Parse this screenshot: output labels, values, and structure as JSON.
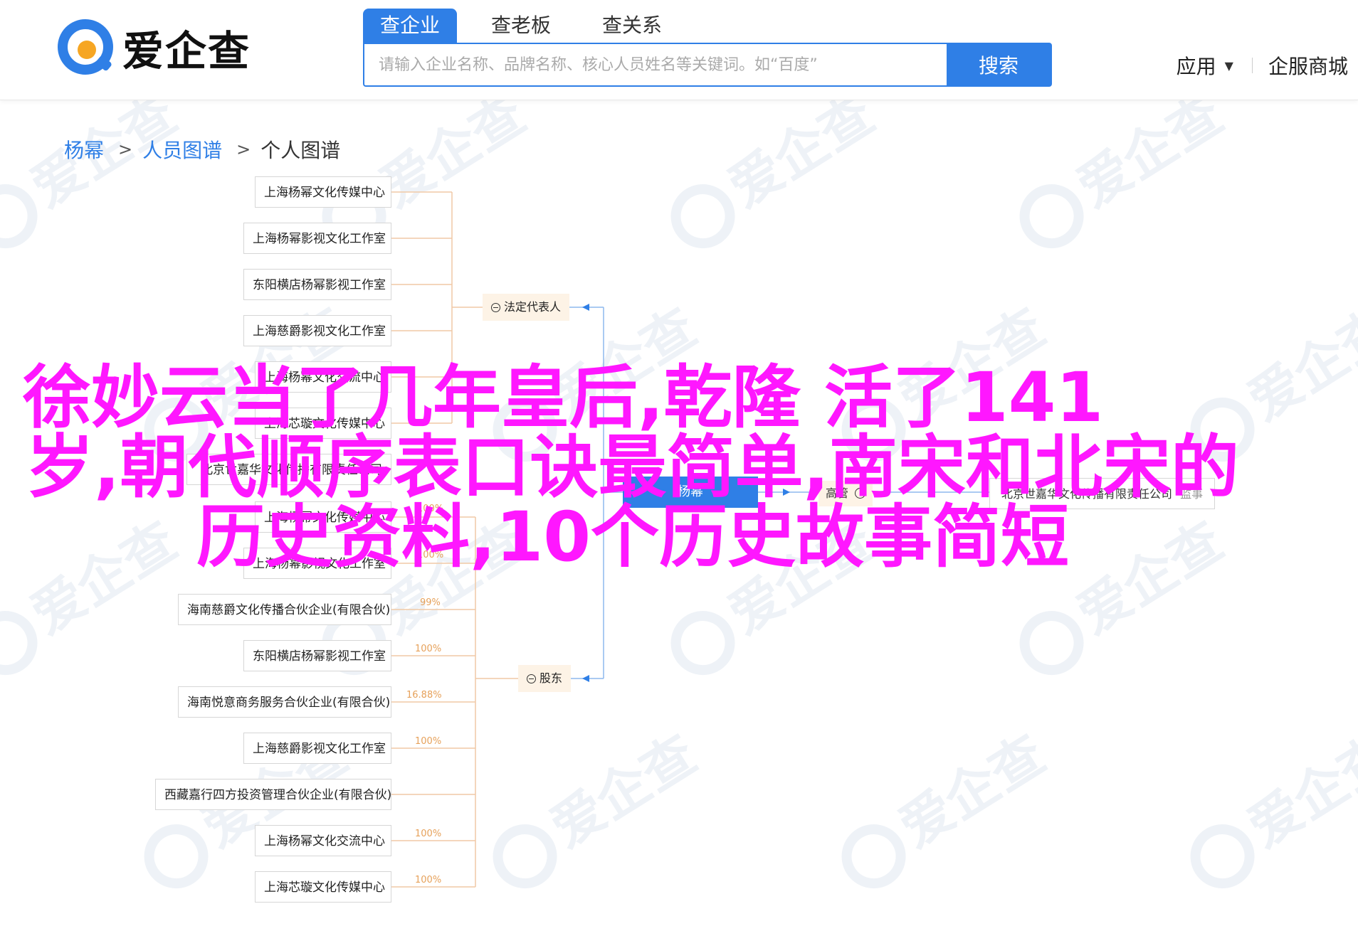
{
  "header": {
    "logo_text": "爱企查",
    "logo_colors": {
      "ring": "#2f7fe6",
      "dot": "#f6a623"
    },
    "search_tabs": [
      {
        "label": "查企业",
        "active": true
      },
      {
        "label": "查老板",
        "active": false
      },
      {
        "label": "查关系",
        "active": false
      }
    ],
    "search_placeholder": "请输入企业名称、品牌名称、核心人员姓名等关键词。如“百度”",
    "search_button": "搜索",
    "apps_label": "应用",
    "enterprise_mall": "企服商城"
  },
  "breadcrumb": {
    "items": [
      "杨幂",
      "人员图谱",
      "个人图谱"
    ]
  },
  "tree": {
    "legal_rep_label": "法定代表人",
    "legal_rep_companies": [
      "上海杨幂文化传媒中心",
      "上海杨幂影视文化工作室",
      "东阳横店杨幂影视工作室",
      "上海慈爵影视文化工作室",
      "上海杨幂文化交流中心",
      "上海芯璇文化传媒中心",
      "北京世嘉华文化传播有限责任公司"
    ],
    "shareholder_label": "股东",
    "shareholder_companies": [
      {
        "name": "上海杨幂文化传媒中心",
        "pct": "100%"
      },
      {
        "name": "上海杨幂影视文化工作室",
        "pct": "100%"
      },
      {
        "name": "海南慈爵文化传播合伙企业(有限合伙)",
        "pct": "99%"
      },
      {
        "name": "东阳横店杨幂影视工作室",
        "pct": "100%"
      },
      {
        "name": "海南悦意商务服务合伙企业(有限合伙)",
        "pct": "16.88%"
      },
      {
        "name": "上海慈爵影视文化工作室",
        "pct": "100%"
      },
      {
        "name": "西藏嘉行四方投资管理合伙企业(有限合伙)",
        "pct": ""
      },
      {
        "name": "上海杨幂文化交流中心",
        "pct": "100%"
      },
      {
        "name": "上海芯璇文化传媒中心",
        "pct": "100%"
      }
    ],
    "center_node": "杨幂",
    "right_label": "高管",
    "right_company": "北京世嘉华文化传播有限责任公司",
    "right_role": "监事"
  },
  "headline": {
    "lines": [
      "徐妙云当了几年皇后,乾隆  活了141",
      "岁,朝代顺序表口诀最简单,南宋和北宋的",
      "历史资料,10个历史故事简短"
    ],
    "color": "#ff17ff"
  },
  "watermark_text": "爱企查"
}
